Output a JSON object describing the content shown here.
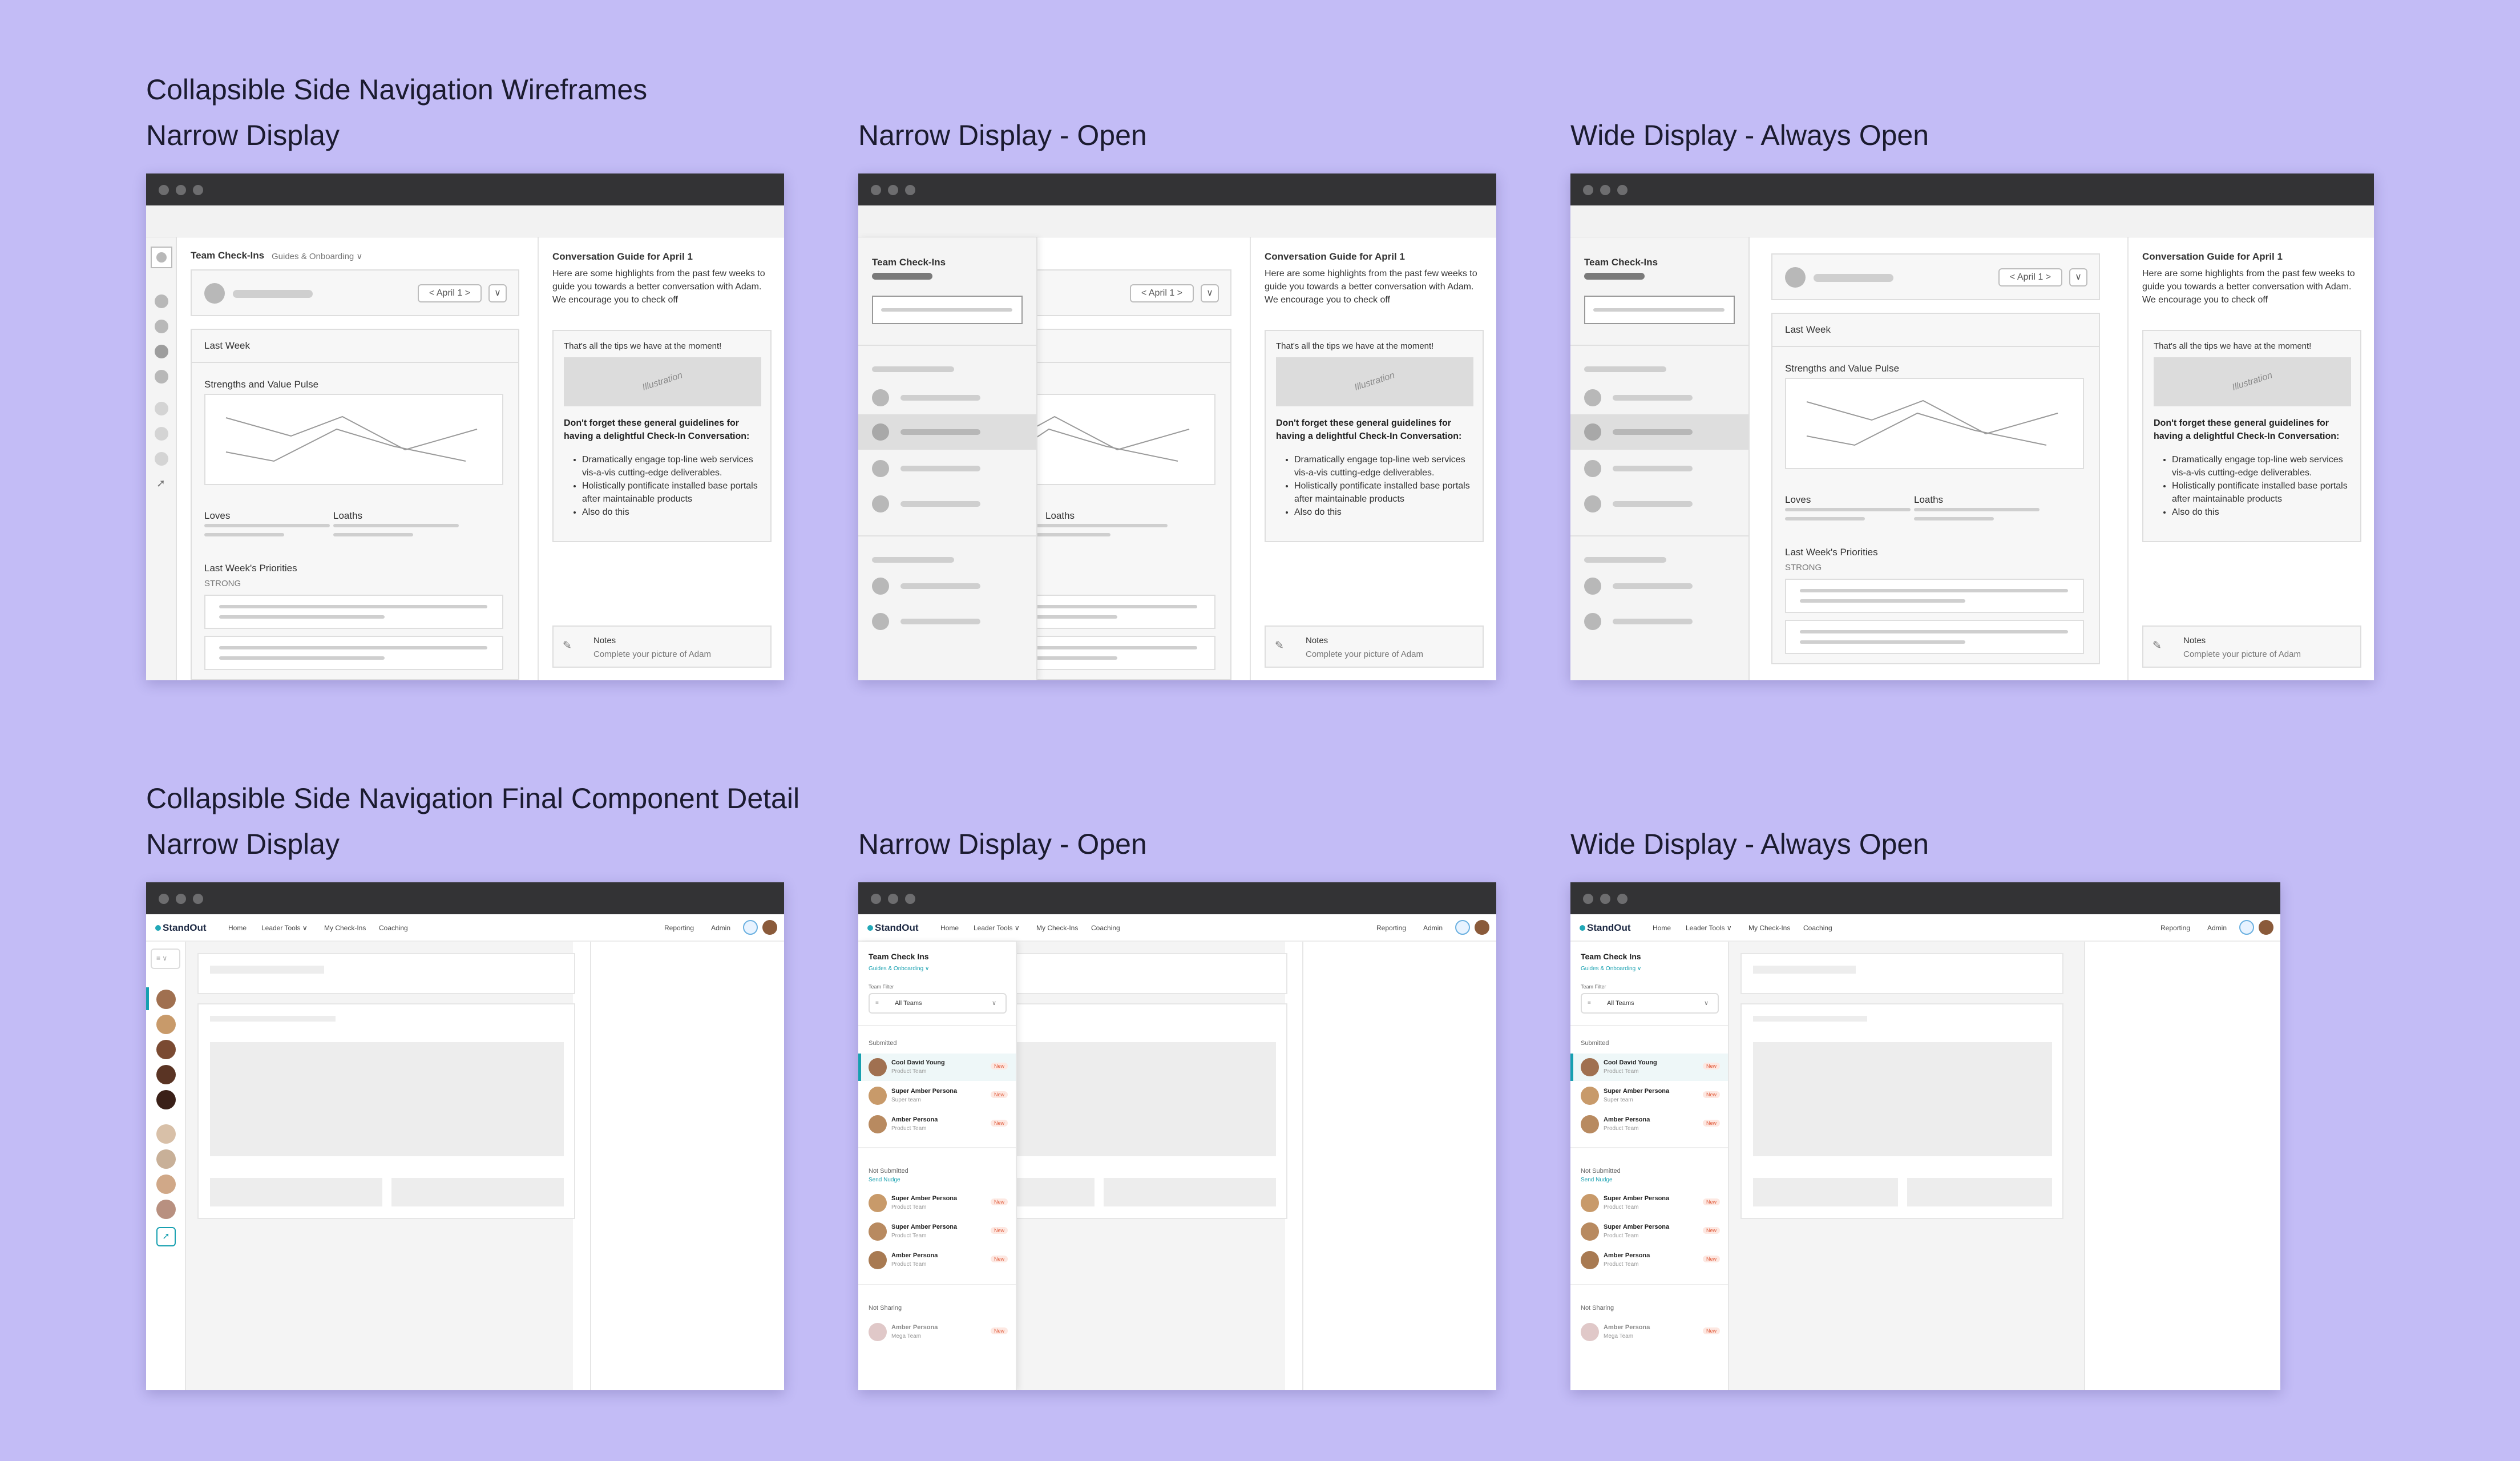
{
  "sections": {
    "wireframes_title": "Collapsible Side Navigation Wireframes",
    "final_title": "Collapsible Side Navigation Final Component Detail"
  },
  "panels": {
    "narrow": "Narrow Display",
    "narrow_open": "Narrow Display - Open",
    "wide": "Wide Display - Always Open"
  },
  "wire": {
    "team_checkins": "Team Check-Ins",
    "guides_onboarding": "Guides & Onboarding ∨",
    "date_button": "< April 1 >",
    "dropdown_btn": "∨",
    "last_week": "Last Week",
    "strengths_pulse": "Strengths and Value Pulse",
    "loves": "Loves",
    "loaths": "Loaths",
    "last_week_priorities": "Last Week's Priorities",
    "strong": "STRONG",
    "guide_title": "Conversation Guide for April 1",
    "guide_intro": "Here are some highlights from the past few weeks to guide you towards a better conversation with Adam. We encourage you to check off",
    "tips_header": "That's all the tips we have at the moment!",
    "illustration": "Illustration",
    "guidelines_title": "Don't forget these general guidelines for having a delightful Check-In Conversation:",
    "guidelines": [
      "Dramatically engage top-line web services vis-a-vis cutting-edge deliverables.",
      "Holistically pontificate installed base portals after maintainable products",
      "Also do this"
    ],
    "notes_title": "Notes",
    "notes_sub": "Complete your picture of Adam"
  },
  "final": {
    "logo": "StandOut",
    "nav": [
      "Home",
      "Leader Tools ∨",
      "My Check-Ins",
      "Coaching"
    ],
    "nav_right": [
      "Reporting",
      "Admin"
    ],
    "panel_title": "Team Check Ins",
    "panel_sub": "Guides & Onboarding ∨",
    "team_filter": "Team Filter",
    "all_teams": "All Teams",
    "submitted": "Submitted",
    "not_submitted": "Not Submitted",
    "send_nudge": "Send Nudge",
    "not_sharing": "Not Sharing",
    "badge": "New",
    "people_submitted": [
      {
        "name": "Cool David Young",
        "team": "Product Team"
      },
      {
        "name": "Super Amber Persona",
        "team": "Super team"
      },
      {
        "name": "Amber Persona",
        "team": "Product Team"
      }
    ],
    "people_not_submitted": [
      {
        "name": "Super Amber Persona",
        "team": "Product Team"
      },
      {
        "name": "Super Amber Persona",
        "team": "Product Team"
      },
      {
        "name": "Amber Persona",
        "team": "Product Team"
      }
    ],
    "people_not_sharing": [
      {
        "name": "Amber Persona",
        "team": "Mega Team"
      }
    ]
  }
}
